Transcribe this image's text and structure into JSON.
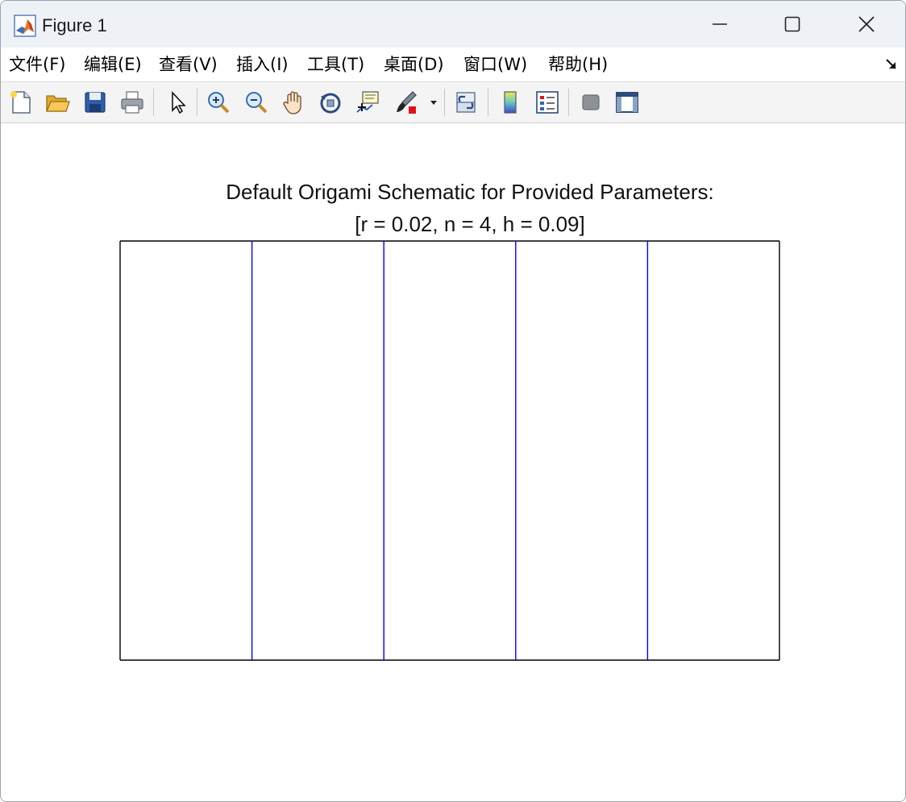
{
  "window": {
    "title": "Figure 1",
    "controls": [
      "minimize",
      "maximize",
      "close"
    ]
  },
  "menubar": {
    "items": [
      {
        "label": "文件(F)"
      },
      {
        "label": "编辑(E)"
      },
      {
        "label": "查看(V)"
      },
      {
        "label": "插入(I)"
      },
      {
        "label": "工具(T)"
      },
      {
        "label": "桌面(D)"
      },
      {
        "label": "窗口(W)"
      },
      {
        "label": "帮助(H)"
      }
    ]
  },
  "toolbar": {
    "icons": [
      "new-figure-icon",
      "open-file-icon",
      "save-icon",
      "print-icon",
      "edit-plot-arrow-icon",
      "zoom-in-icon",
      "zoom-out-icon",
      "pan-hand-icon",
      "rotate-3d-icon",
      "data-cursor-icon",
      "brush-icon",
      "brush-dropdown-icon",
      "link-plot-icon",
      "colorbar-icon",
      "legend-icon",
      "hide-plot-tools-icon",
      "show-plot-tools-icon"
    ]
  },
  "figure": {
    "title_line1": "Default Origami Schematic for Provided Parameters:",
    "title_line2": "[r = 0.02, n = 4, h = 0.09]"
  },
  "chart_data": {
    "type": "line",
    "title": "Default Origami Schematic for Provided Parameters: [r = 0.02, n = 4, h = 0.09]",
    "xlabel": "",
    "ylabel": "",
    "axes_visible": false,
    "xlim": [
      0,
      5
    ],
    "ylim": [
      0,
      1
    ],
    "series": [
      {
        "color": "#000000",
        "segments": [
          [
            [
              0,
              0
            ],
            [
              5,
              0
            ]
          ],
          [
            [
              5,
              0
            ],
            [
              5,
              1
            ]
          ],
          [
            [
              5,
              1
            ],
            [
              0,
              1
            ]
          ],
          [
            [
              0,
              1
            ],
            [
              0,
              0
            ]
          ]
        ]
      },
      {
        "color": "#0000ff",
        "segments": [
          [
            [
              1,
              0
            ],
            [
              1,
              1
            ]
          ],
          [
            [
              2,
              0
            ],
            [
              2,
              1
            ]
          ],
          [
            [
              3,
              0
            ],
            [
              3,
              1
            ]
          ],
          [
            [
              4,
              0
            ],
            [
              4,
              1
            ]
          ]
        ]
      }
    ]
  }
}
